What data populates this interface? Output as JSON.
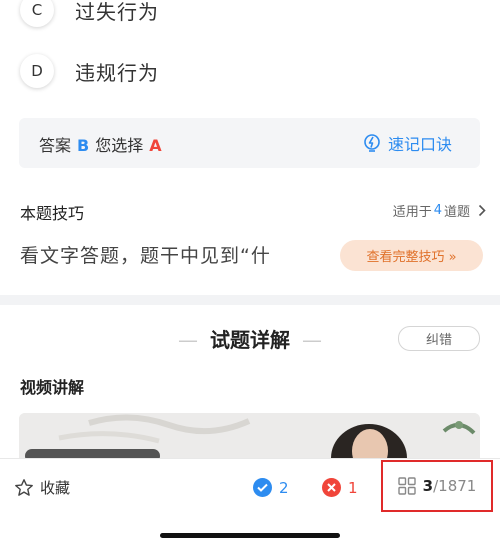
{
  "options": [
    {
      "letter": "C",
      "text": "过失行为"
    },
    {
      "letter": "D",
      "text": "违规行为"
    }
  ],
  "answer": {
    "label": "答案",
    "correct": "B",
    "your_label": "您选择",
    "yours": "A",
    "mnemonic_label": "速记口诀",
    "correct_color": "#2d8cf0",
    "wrong_color": "#f0453a"
  },
  "tip": {
    "title": "本题技巧",
    "apply_prefix": "适用于",
    "apply_count": "4",
    "apply_suffix": "道题",
    "text": "看文字答题，题干中见到“什",
    "full_button": "查看完整技巧 »"
  },
  "detail": {
    "title": "试题详解",
    "correct_button": "纠错",
    "video_label": "视频讲解"
  },
  "bottom_bar": {
    "favorite_label": "收藏",
    "right_count": "2",
    "wrong_count": "1",
    "current": "3",
    "total": "/1871"
  }
}
